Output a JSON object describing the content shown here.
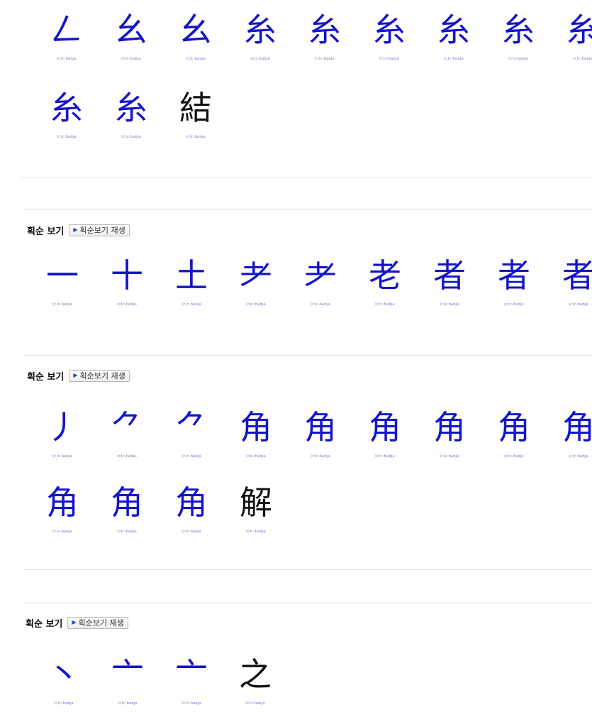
{
  "header_label": "획순 보기",
  "play_button_label": "획순보기 재생",
  "credit": "(c)c-hanja",
  "colors": {
    "stroke_in_progress": "#1414c8",
    "stroke_complete": "#111111",
    "credit": "#7777cc"
  },
  "sections": [
    {
      "character": "結",
      "has_header": false,
      "frames": [
        "𠃋",
        "幺",
        "幺",
        "糸",
        "糸",
        "糸",
        "糸",
        "糸",
        "糸",
        "糸",
        "糸",
        "結"
      ]
    },
    {
      "character": "者",
      "has_header": true,
      "frames": [
        "一",
        "十",
        "土",
        "耂",
        "耂",
        "老",
        "者",
        "者",
        "者"
      ]
    },
    {
      "character": "解",
      "has_header": true,
      "frames": [
        "丿",
        "⺈",
        "⺈",
        "角",
        "角",
        "角",
        "角",
        "角",
        "角",
        "角",
        "角",
        "角",
        "解"
      ]
    },
    {
      "character": "之",
      "has_header": true,
      "frames": [
        "丶",
        "亠",
        "亠",
        "之"
      ]
    }
  ]
}
